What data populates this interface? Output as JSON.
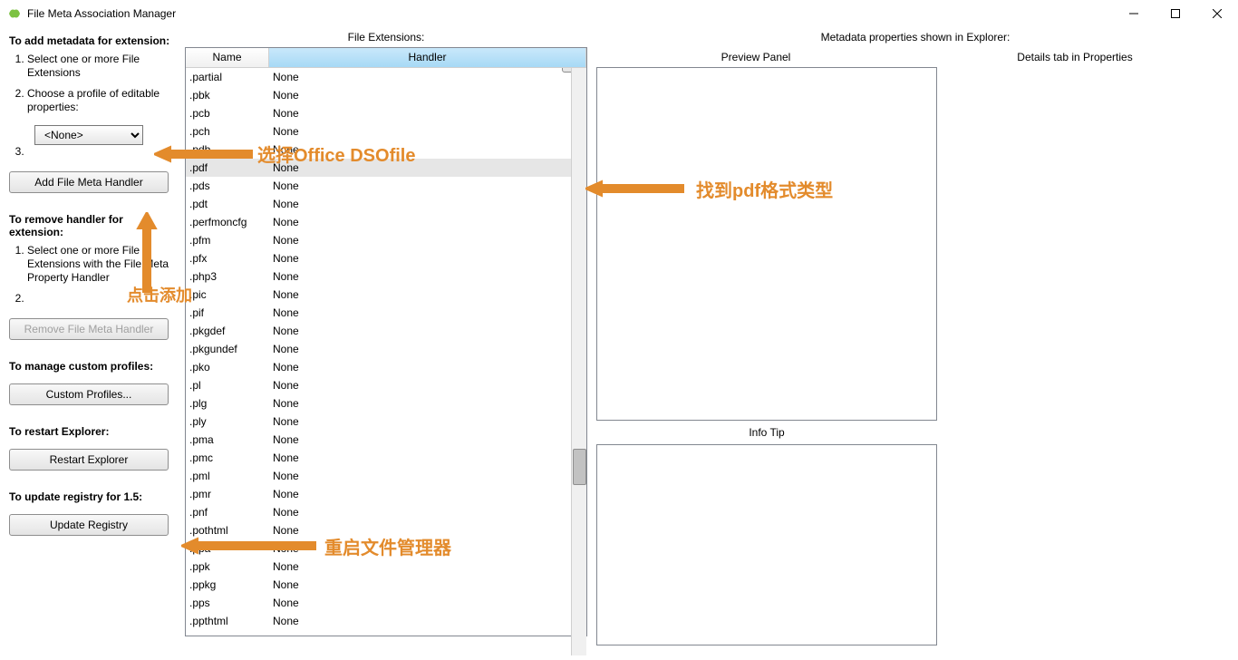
{
  "window": {
    "title": "File Meta Association Manager"
  },
  "left": {
    "add_head": "To add metadata for extension:",
    "add_step1": "Select one or more File Extensions",
    "add_step2": "Choose a profile of editable properties:",
    "combo_value": "<None>",
    "add_step3": "",
    "add_button": "Add File Meta Handler",
    "remove_head": "To remove handler for extension:",
    "remove_step1": "Select one or more File Extensions with the File Meta Property Handler",
    "remove_step2": "",
    "remove_button": "Remove File Meta Handler",
    "manage_head": "To manage custom profiles:",
    "manage_button": "Custom Profiles...",
    "restart_head": "To restart Explorer:",
    "restart_button": "Restart Explorer",
    "update_head": "To update registry for 1.5:",
    "update_button": "Update Registry"
  },
  "middle": {
    "label": "File Extensions:",
    "col_name": "Name",
    "col_handler": "Handler",
    "rows": [
      {
        "name": ".partial",
        "handler": "None"
      },
      {
        "name": ".pbk",
        "handler": "None"
      },
      {
        "name": ".pcb",
        "handler": "None"
      },
      {
        "name": ".pch",
        "handler": "None"
      },
      {
        "name": ".pdb",
        "handler": "None"
      },
      {
        "name": ".pdf",
        "handler": "None",
        "selected": true
      },
      {
        "name": ".pds",
        "handler": "None"
      },
      {
        "name": ".pdt",
        "handler": "None"
      },
      {
        "name": ".perfmoncfg",
        "handler": "None"
      },
      {
        "name": ".pfm",
        "handler": "None"
      },
      {
        "name": ".pfx",
        "handler": "None"
      },
      {
        "name": ".php3",
        "handler": "None"
      },
      {
        "name": ".pic",
        "handler": "None"
      },
      {
        "name": ".pif",
        "handler": "None"
      },
      {
        "name": ".pkgdef",
        "handler": "None"
      },
      {
        "name": ".pkgundef",
        "handler": "None"
      },
      {
        "name": ".pko",
        "handler": "None"
      },
      {
        "name": ".pl",
        "handler": "None"
      },
      {
        "name": ".plg",
        "handler": "None"
      },
      {
        "name": ".ply",
        "handler": "None"
      },
      {
        "name": ".pma",
        "handler": "None"
      },
      {
        "name": ".pmc",
        "handler": "None"
      },
      {
        "name": ".pml",
        "handler": "None"
      },
      {
        "name": ".pmr",
        "handler": "None"
      },
      {
        "name": ".pnf",
        "handler": "None"
      },
      {
        "name": ".pothtml",
        "handler": "None"
      },
      {
        "name": ".ppa",
        "handler": "None"
      },
      {
        "name": ".ppk",
        "handler": "None"
      },
      {
        "name": ".ppkg",
        "handler": "None"
      },
      {
        "name": ".pps",
        "handler": "None"
      },
      {
        "name": ".ppthtml",
        "handler": "None"
      }
    ]
  },
  "right": {
    "label": "Metadata properties shown in Explorer:",
    "preview_head": "Preview Panel",
    "details_head": "Details tab in Properties",
    "info_head": "Info Tip"
  },
  "annotations": {
    "a1": "选择Office DSOfile",
    "a2": "找到pdf格式类型",
    "a3": "点击添加",
    "a4": "重启文件管理器"
  }
}
